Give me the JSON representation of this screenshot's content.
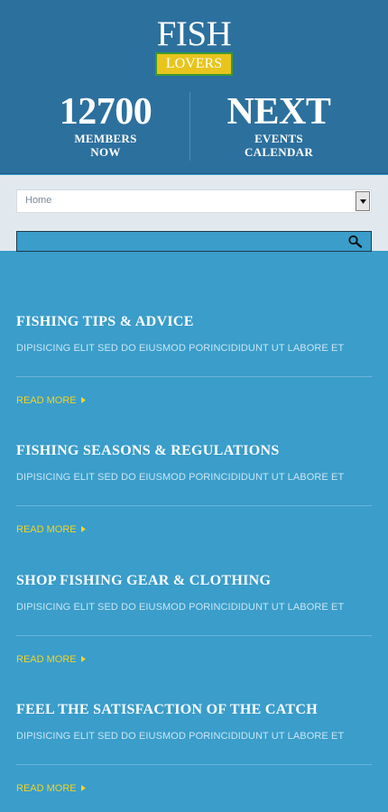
{
  "logo": {
    "title": "FISH",
    "subtitle": "LOVERS"
  },
  "stats": [
    {
      "value": "12700",
      "line1": "MEMBERS",
      "line2": "NOW"
    },
    {
      "value": "NEXT",
      "line1": "EVENTS",
      "line2": "CALENDAR"
    }
  ],
  "nav": {
    "select_value": "Home",
    "search_placeholder": ""
  },
  "articles": [
    {
      "title": "FISHING TIPS & ADVICE",
      "text": "DIPISICING ELIT SED DO EIUSMOD PORINCIDIDUNT UT LABORE ET",
      "link": "READ MORE"
    },
    {
      "title": "FISHING SEASONS & REGULATIONS",
      "text": "DIPISICING ELIT SED DO EIUSMOD PORINCIDIDUNT UT LABORE ET",
      "link": "READ MORE"
    },
    {
      "title": "SHOP FISHING GEAR & CLOTHING",
      "text": "DIPISICING ELIT SED DO EIUSMOD PORINCIDIDUNT UT LABORE ET",
      "link": "READ MORE"
    },
    {
      "title": "FEEL THE SATISFACTION OF THE CATCH",
      "text": "DIPISICING ELIT SED DO EIUSMOD PORINCIDIDUNT UT LABORE ET",
      "link": "READ MORE"
    }
  ],
  "colors": {
    "header_bg": "#2c709e",
    "page_bg": "#3a9dca",
    "accent_yellow": "#f2d428",
    "logo_badge": "#e8c51c"
  },
  "icons": {
    "search": "search-icon",
    "dropdown": "triangle-down-icon",
    "link_caret": "triangle-right-icon"
  }
}
